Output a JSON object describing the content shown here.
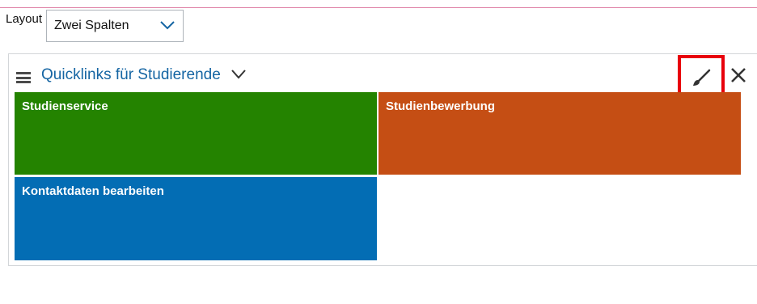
{
  "layout": {
    "label": "Layout",
    "selected": "Zwei Spalten"
  },
  "widget": {
    "title": "Quicklinks für Studierende",
    "tiles": [
      {
        "label": "Studienservice",
        "color": "#248300"
      },
      {
        "label": "Studienbewerbung",
        "color": "#c54e14"
      },
      {
        "label": "Kontaktdaten bearbeiten",
        "color": "#036db4"
      }
    ]
  },
  "colors": {
    "accent": "#1565a3",
    "highlight": "#e8000b"
  },
  "icons": {
    "select_chevron": "chevron-down-icon",
    "menu": "hamburger-icon",
    "collapse": "chevron-down-icon",
    "edit": "paintbrush-icon",
    "close": "close-icon"
  }
}
